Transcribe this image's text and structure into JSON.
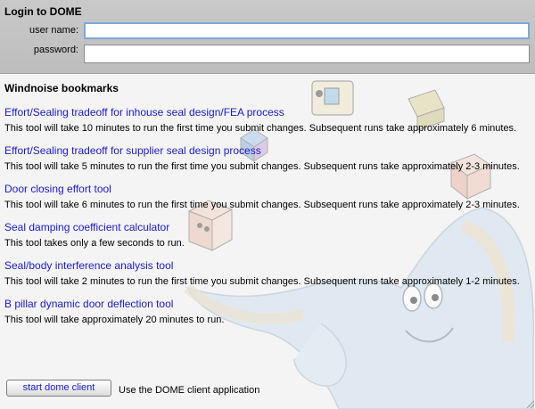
{
  "login": {
    "title": "Login to DOME",
    "username_label": "user name:",
    "username_value": "",
    "password_label": "password:",
    "password_value": ""
  },
  "bookmarks": {
    "title": "Windnoise bookmarks",
    "items": [
      {
        "label": "Effort/Sealing tradeoff for inhouse seal design/FEA process",
        "desc": "This tool will take 10 minutes to run the first time you submit changes. Subsequent runs take approximately 6 minutes."
      },
      {
        "label": "Effort/Sealing tradeoff for supplier seal design process",
        "desc": "This tool will take 5 minutes to run the first time you submit changes. Subsequent runs take approximately 2-3 minutes."
      },
      {
        "label": "Door closing effort tool",
        "desc": "This tool will take 6 minutes to run the first time you submit changes. Subsequent runs take approximately 2-3 minutes."
      },
      {
        "label": "Seal damping coefficient calculator",
        "desc": "This tool takes only a few seconds to run."
      },
      {
        "label": "Seal/body interference analysis tool",
        "desc": "This tool will take 2 minutes to run the first time you submit changes. Subsequent runs take approximately 1-2 minutes."
      },
      {
        "label": "B pillar dynamic door deflection tool",
        "desc": "This tool will take approximately 20 minutes to run."
      }
    ]
  },
  "footer": {
    "button_label": "start dome client",
    "button_desc": "Use the DOME client application"
  },
  "colors": {
    "link": "#1a1ac8",
    "login_bg": "#c4c4c4",
    "content_bg": "#f4f4f4"
  }
}
